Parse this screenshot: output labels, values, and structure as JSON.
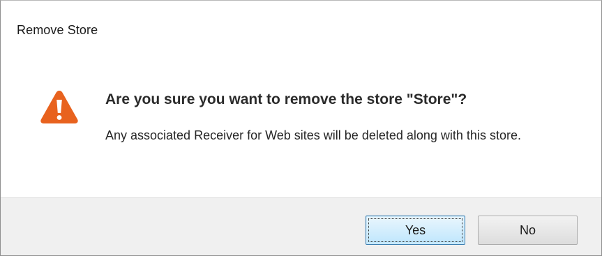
{
  "dialog": {
    "title": "Remove Store",
    "heading": "Are you sure you want to remove the store \"Store\"?",
    "message": "Any associated Receiver for Web sites will be deleted along with this store.",
    "icon": "warning-icon",
    "buttons": {
      "yes_label": "Yes",
      "no_label": "No"
    }
  },
  "colors": {
    "warning": "#e8621e",
    "focused_button_border": "#3c7fb1",
    "button_bar": "#f0f0f0"
  }
}
